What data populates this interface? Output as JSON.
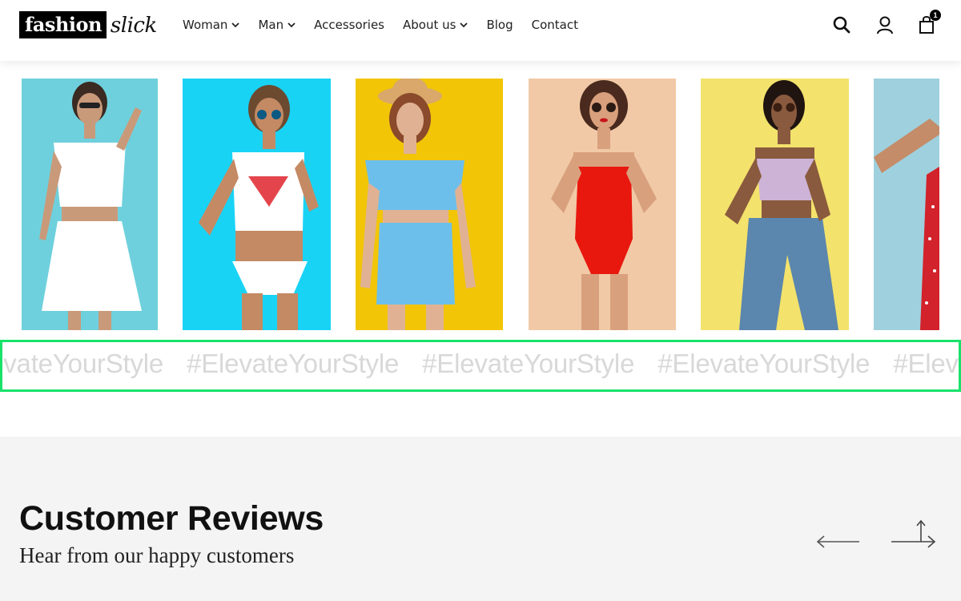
{
  "brand": {
    "logo_primary": "fashion",
    "logo_script": "slick"
  },
  "nav": {
    "items": [
      {
        "label": "Woman",
        "has_dropdown": true
      },
      {
        "label": "Man",
        "has_dropdown": true
      },
      {
        "label": "Accessories",
        "has_dropdown": false
      },
      {
        "label": "About us",
        "has_dropdown": true
      },
      {
        "label": "Blog",
        "has_dropdown": false
      },
      {
        "label": "Contact",
        "has_dropdown": false
      }
    ]
  },
  "header_icons": {
    "search": "search-icon",
    "account": "user-icon",
    "cart": "shopping-bag-icon",
    "cart_count": "1"
  },
  "gallery": {
    "photos": [
      {
        "name": "model-white-outfit",
        "background": "#6fd0dd",
        "top": "#ffffff",
        "bottom": "#ffffff"
      },
      {
        "name": "model-watermelon-top",
        "background": "#19d3f5",
        "top": "#ffffff",
        "bottom": "#ffffff"
      },
      {
        "name": "model-blue-set",
        "background": "#f2c507",
        "top": "#6cbfeb",
        "bottom": "#6cbfeb"
      },
      {
        "name": "model-red-swimsuit",
        "background": "#f1c9a6",
        "top": "#e8180f",
        "bottom": "#e8180f"
      },
      {
        "name": "model-lilac-top-jeans",
        "background": "#f3e26c",
        "top": "#cdb3d6",
        "bottom": "#5b86ad"
      },
      {
        "name": "model-red-dress",
        "background": "#9fd0de",
        "top": "#d2222b",
        "bottom": "#d2222b"
      }
    ]
  },
  "marquee": {
    "items": [
      "#ElevateYourStyle",
      "#ElevateYourStyle",
      "#ElevateYourStyle",
      "#ElevateYourStyle",
      "#ElevateYourStyle"
    ]
  },
  "reviews": {
    "title": "Customer Reviews",
    "subtitle": "Hear from our happy customers",
    "prev_icon": "arrow-left-icon",
    "next_icon": "arrow-right-icon"
  },
  "colors": {
    "accent_outline": "#19e26b",
    "marquee_text": "#d8d8d8",
    "reviews_background": "#f4f4f4"
  }
}
